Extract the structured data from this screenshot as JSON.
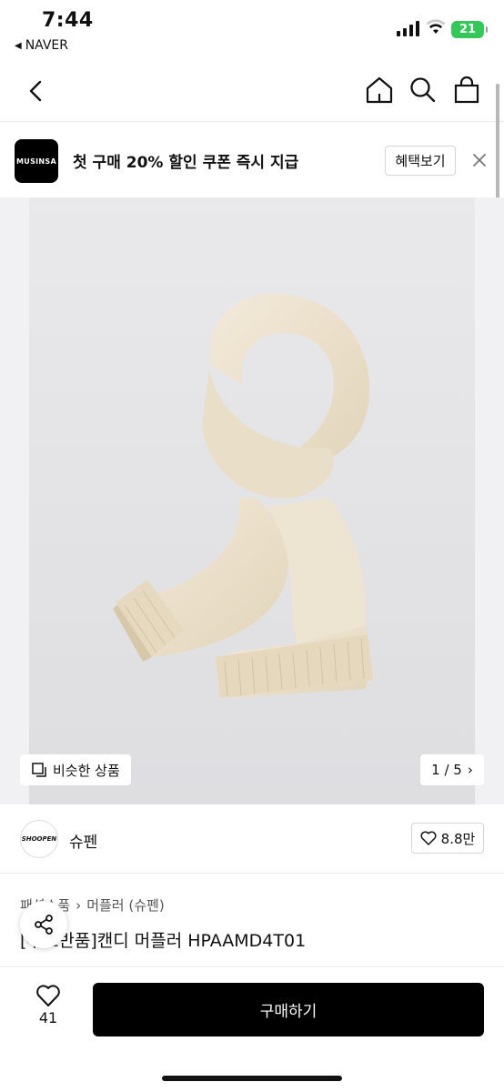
{
  "status_bar": {
    "time": "7:44",
    "back_app": "NAVER",
    "battery": "21"
  },
  "nav": {
    "back_icon": "chevron-left-icon",
    "home_icon": "home-icon",
    "search_icon": "search-icon",
    "cart_icon": "shopping-bag-icon"
  },
  "promo": {
    "logo_text": "MUSINSA",
    "message": "첫 구매 20% 할인 쿠폰 즉시 지급",
    "button_label": "혜택보기"
  },
  "gallery": {
    "similar_label": "비슷한 상품",
    "pager_text": "1 / 5"
  },
  "brand": {
    "logo_text": "SHOOPEN",
    "name": "슈펜",
    "likes": "8.8만"
  },
  "product": {
    "breadcrumb": [
      "패션소품",
      "머플러 (슈펜)"
    ],
    "title": "[무료반품]캔디 머플러 HPAAMD4T01"
  },
  "bottom_bar": {
    "like_count": "41",
    "buy_label": "구매하기"
  },
  "colors": {
    "scarf": "#ece1cc",
    "battery": "#34c759",
    "buy_button": "#000000"
  }
}
